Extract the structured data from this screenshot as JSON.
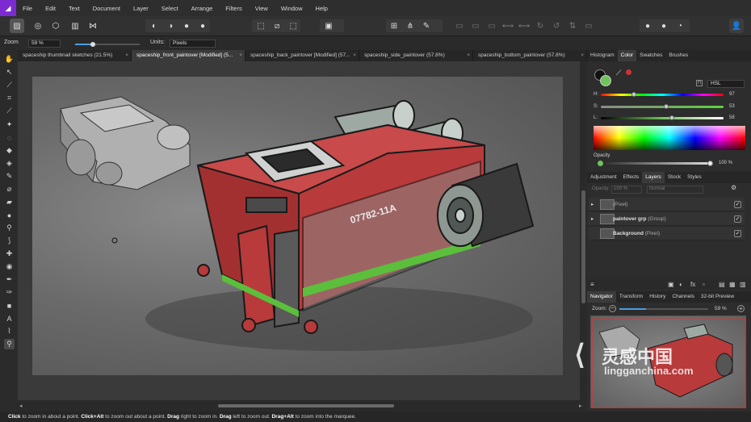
{
  "menubar": {
    "items": [
      "File",
      "Edit",
      "Text",
      "Document",
      "Layer",
      "Select",
      "Arrange",
      "Filters",
      "View",
      "Window",
      "Help"
    ]
  },
  "context_bar": {
    "zoom_label": "Zoom",
    "zoom_value": "59 %",
    "units_label": "Units:",
    "units_value": "Pixels"
  },
  "document_tabs": [
    {
      "label": "spaceship thumbnail sketches (21.5%)",
      "active": false
    },
    {
      "label": "spaceship_front_paintover [Modified] (5...",
      "active": true
    },
    {
      "label": "spaceship_back_paintover [Modified] (57...",
      "active": false
    },
    {
      "label": "spaceship_side_paintover (57.8%)",
      "active": false
    },
    {
      "label": "spaceship_bottom_paintover (57.8%)",
      "active": false
    }
  ],
  "color_panel": {
    "tabs": [
      "Histogram",
      "Color",
      "Swatches",
      "Brushes"
    ],
    "active_tab": "Color",
    "model": "HSL",
    "h_label": "H:",
    "h_value": "97",
    "s_label": "S:",
    "s_value": "53",
    "l_label": "L:",
    "l_value": "58",
    "opacity_label": "Opacity",
    "opacity_value": "100 %",
    "h_fraction": 0.27,
    "s_fraction": 0.53,
    "l_fraction": 0.58
  },
  "layers_panel": {
    "tabs": [
      "Adjustment",
      "Effects",
      "Layers",
      "Stock",
      "Styles"
    ],
    "active_tab": "Layers",
    "opacity_label": "Opacity:",
    "opacity_value": "100 %",
    "blend_mode": "Normal",
    "layers": [
      {
        "name": "",
        "type": "(Pixel)",
        "visible": true
      },
      {
        "name": "paintover grp",
        "type": "(Group)",
        "visible": true
      },
      {
        "name": "Background",
        "type": "(Pixel)",
        "visible": true
      }
    ]
  },
  "navigator_panel": {
    "tabs": [
      "Navigator",
      "Transform",
      "History",
      "Channels",
      "32-bit Preview"
    ],
    "active_tab": "Navigator",
    "zoom_label": "Zoom:",
    "zoom_value": "59 %",
    "zoom_fraction": 0.3
  },
  "canvas": {
    "ship_decal": "07782-11A"
  },
  "watermark": {
    "logo_text": "灵感中国",
    "url_text": "lingganchina.com"
  },
  "statusbar": {
    "parts": [
      {
        "text": "Click",
        "bold": true
      },
      {
        "text": " to zoom in about a point. ",
        "bold": false
      },
      {
        "text": "Click+Alt",
        "bold": true
      },
      {
        "text": " to zoom out about a point. ",
        "bold": false
      },
      {
        "text": "Drag",
        "bold": true
      },
      {
        "text": " right to zoom in. ",
        "bold": false
      },
      {
        "text": "Drag",
        "bold": true
      },
      {
        "text": " left to zoom out. ",
        "bold": false
      },
      {
        "text": "Drag+Alt",
        "bold": true
      },
      {
        "text": " to zoom into the marquee.",
        "bold": false
      }
    ]
  },
  "colors": {
    "accent": "#7c2bd1",
    "primary_color": "#6fc35a",
    "ship_red": "#b83a3a",
    "stripe_green": "#5bbf3c"
  }
}
